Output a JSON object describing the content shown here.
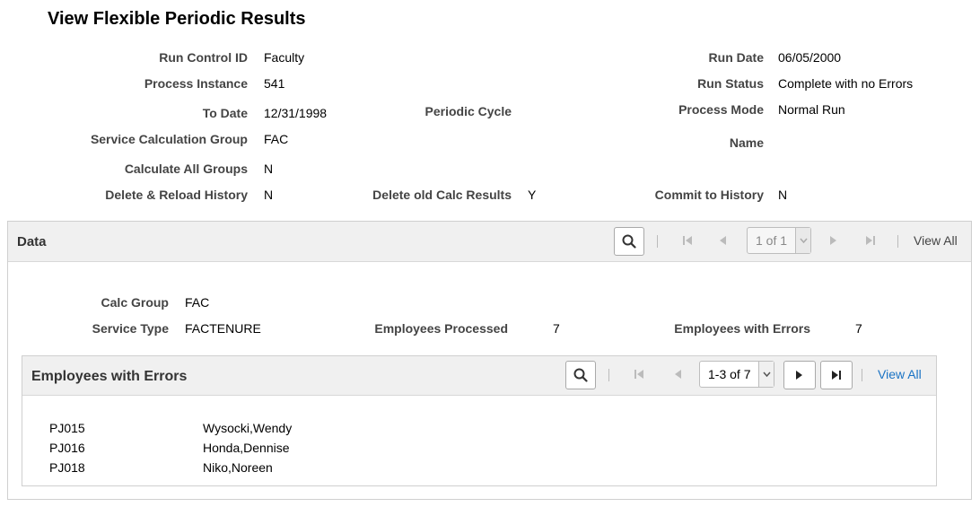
{
  "page": {
    "title": "View Flexible Periodic Results"
  },
  "header_fields": {
    "run_control_id": {
      "label": "Run Control ID",
      "value": "Faculty"
    },
    "run_date": {
      "label": "Run Date",
      "value": "06/05/2000"
    },
    "process_instance": {
      "label": "Process Instance",
      "value": "541"
    },
    "run_status": {
      "label": "Run Status",
      "value": "Complete with no Errors"
    },
    "to_date": {
      "label": "To Date",
      "value": "12/31/1998"
    },
    "periodic_cycle": {
      "label": "Periodic Cycle",
      "value": ""
    },
    "process_mode": {
      "label": "Process Mode",
      "value": "Normal Run"
    },
    "service_calc_group": {
      "label": "Service Calculation Group",
      "value": "FAC"
    },
    "name": {
      "label": "Name",
      "value": ""
    },
    "calc_all_groups": {
      "label": "Calculate All Groups",
      "value": "N"
    },
    "delete_reload_history": {
      "label": "Delete & Reload History",
      "value": "N"
    },
    "delete_old_calc": {
      "label": "Delete old Calc Results",
      "value": "Y"
    },
    "commit_history": {
      "label": "Commit to History",
      "value": "N"
    }
  },
  "data_section": {
    "title": "Data",
    "pager_text": "1 of 1",
    "view_all": "View All",
    "calc_group": {
      "label": "Calc Group",
      "value": "FAC"
    },
    "service_type": {
      "label": "Service Type",
      "value": "FACTENURE"
    },
    "employees_processed": {
      "label": "Employees Processed",
      "value": "7"
    },
    "employees_with_errors_count": {
      "label": "Employees with Errors",
      "value": "7"
    }
  },
  "errors_grid": {
    "title": "Employees with Errors",
    "pager_text": "1-3 of 7",
    "view_all": "View All",
    "rows": [
      {
        "id": "PJ015",
        "name": "Wysocki,Wendy"
      },
      {
        "id": "PJ016",
        "name": "Honda,Dennise"
      },
      {
        "id": "PJ018",
        "name": "Niko,Noreen"
      }
    ]
  },
  "colors": {
    "link": "#1a73c4",
    "header_bg": "#f0f0f0",
    "disabled_icon": "#bbbbbb"
  }
}
